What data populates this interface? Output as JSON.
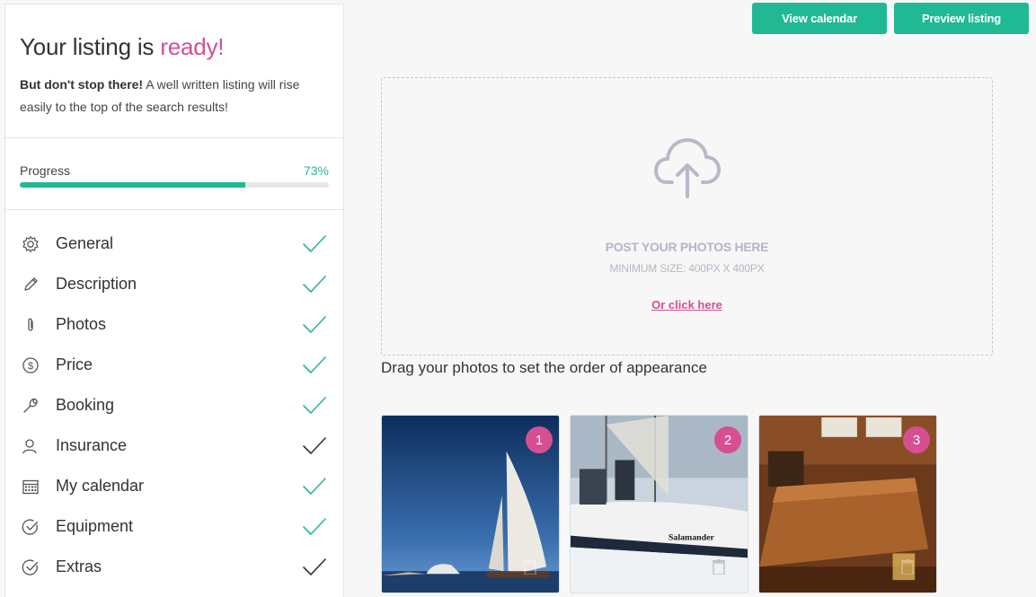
{
  "sidebar": {
    "title_prefix": "Your listing is ",
    "title_accent": "ready!",
    "desc_bold": "But don't stop there!",
    "desc_rest": " A well written listing will rise easily to the top of the search results!",
    "progress_label": "Progress",
    "progress_percent": "73%",
    "progress_value": 73,
    "steps": [
      {
        "label": "General",
        "icon": "gear-icon",
        "check_color": "#2bb594"
      },
      {
        "label": "Description",
        "icon": "pencil-icon",
        "check_color": "#2bb594"
      },
      {
        "label": "Photos",
        "icon": "paperclip-icon",
        "check_color": "#2bb594"
      },
      {
        "label": "Price",
        "icon": "dollar-icon",
        "check_color": "#2bb594"
      },
      {
        "label": "Booking",
        "icon": "wrench-icon",
        "check_color": "#2bb594"
      },
      {
        "label": "Insurance",
        "icon": "user-icon",
        "check_color": "#333333"
      },
      {
        "label": "My calendar",
        "icon": "calendar-icon",
        "check_color": "#2bb594"
      },
      {
        "label": "Equipment",
        "icon": "check-circle-icon",
        "check_color": "#2bb594"
      },
      {
        "label": "Extras",
        "icon": "check-circle-icon",
        "check_color": "#333333"
      }
    ]
  },
  "toolbar": {
    "view_calendar": "View calendar",
    "preview_listing": "Preview listing"
  },
  "upload": {
    "title": "POST YOUR PHOTOS HERE",
    "min_size": "MINIMUM SIZE: 400PX X 400PX",
    "click_here": "Or click here"
  },
  "hint": "Drag your photos to set the order of appearance",
  "photos": [
    {
      "order": "1"
    },
    {
      "order": "2"
    },
    {
      "order": "3"
    }
  ],
  "colors": {
    "accent_pink": "#d64f92",
    "primary_green": "#21b994",
    "check_green": "#2bb594"
  }
}
